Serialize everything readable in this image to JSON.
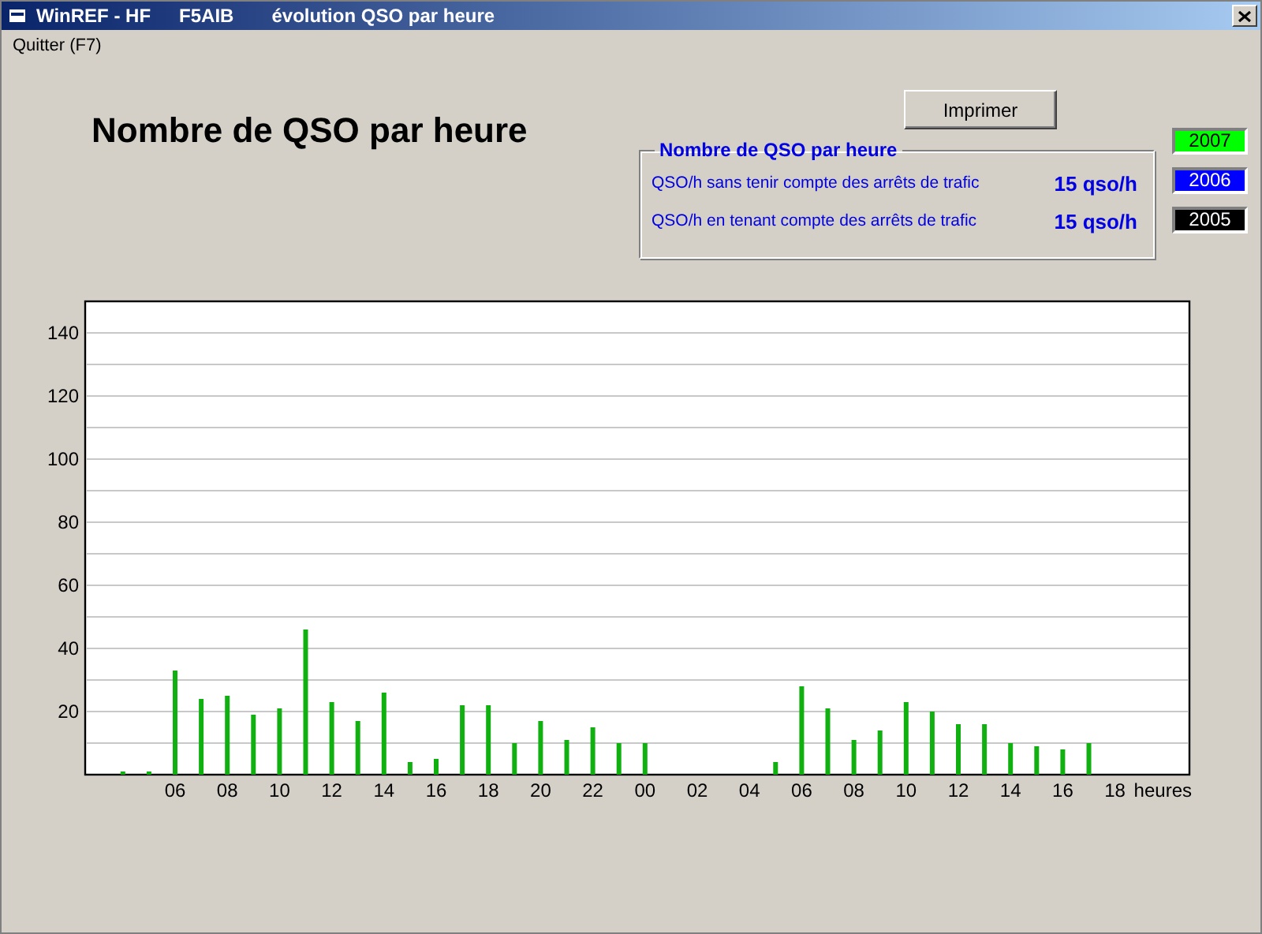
{
  "window": {
    "title_parts": [
      "WinREF - HF",
      "F5AIB",
      "évolution QSO par heure"
    ]
  },
  "menu": [
    "Quitter (F7)"
  ],
  "heading": "Nombre de QSO par heure",
  "print_button": "Imprimer",
  "rate_group": {
    "title": "Nombre de QSO par heure",
    "rows": [
      {
        "label": "QSO/h sans tenir compte des arrêts de trafic",
        "value": "15 qso/h"
      },
      {
        "label": "QSO/h en tenant compte des arrêts de trafic",
        "value": "15 qso/h"
      }
    ]
  },
  "years": [
    {
      "label": "2007",
      "color": "#00ff00"
    },
    {
      "label": "2006",
      "color": "#0000ff"
    },
    {
      "label": "2005",
      "color": "#000000"
    }
  ],
  "chart": {
    "chart_data": {
      "type": "bar",
      "xlabel": "heures",
      "categories": [
        null,
        null,
        "06",
        null,
        "08",
        null,
        "10",
        null,
        "12",
        null,
        "14",
        null,
        "16",
        null,
        "18",
        null,
        "20",
        null,
        "22",
        null,
        "00",
        null,
        "02",
        null,
        "04",
        null,
        "06",
        null,
        "08",
        null,
        "10",
        null,
        "12",
        null,
        "14",
        null,
        "16",
        null,
        "18"
      ],
      "series": [
        {
          "color": "#11b011",
          "values": [
            1,
            1,
            33,
            24,
            25,
            19,
            21,
            46,
            23,
            17,
            26,
            4,
            5,
            22,
            22,
            10,
            17,
            11,
            15,
            10,
            10,
            0,
            0,
            0,
            0,
            4,
            28,
            21,
            11,
            14,
            23,
            20,
            16,
            16,
            10,
            9,
            8,
            10,
            0
          ]
        }
      ],
      "ylim": [
        0,
        150
      ],
      "grid": true,
      "yticks": [
        20,
        40,
        60,
        80,
        100,
        120,
        140
      ]
    }
  }
}
